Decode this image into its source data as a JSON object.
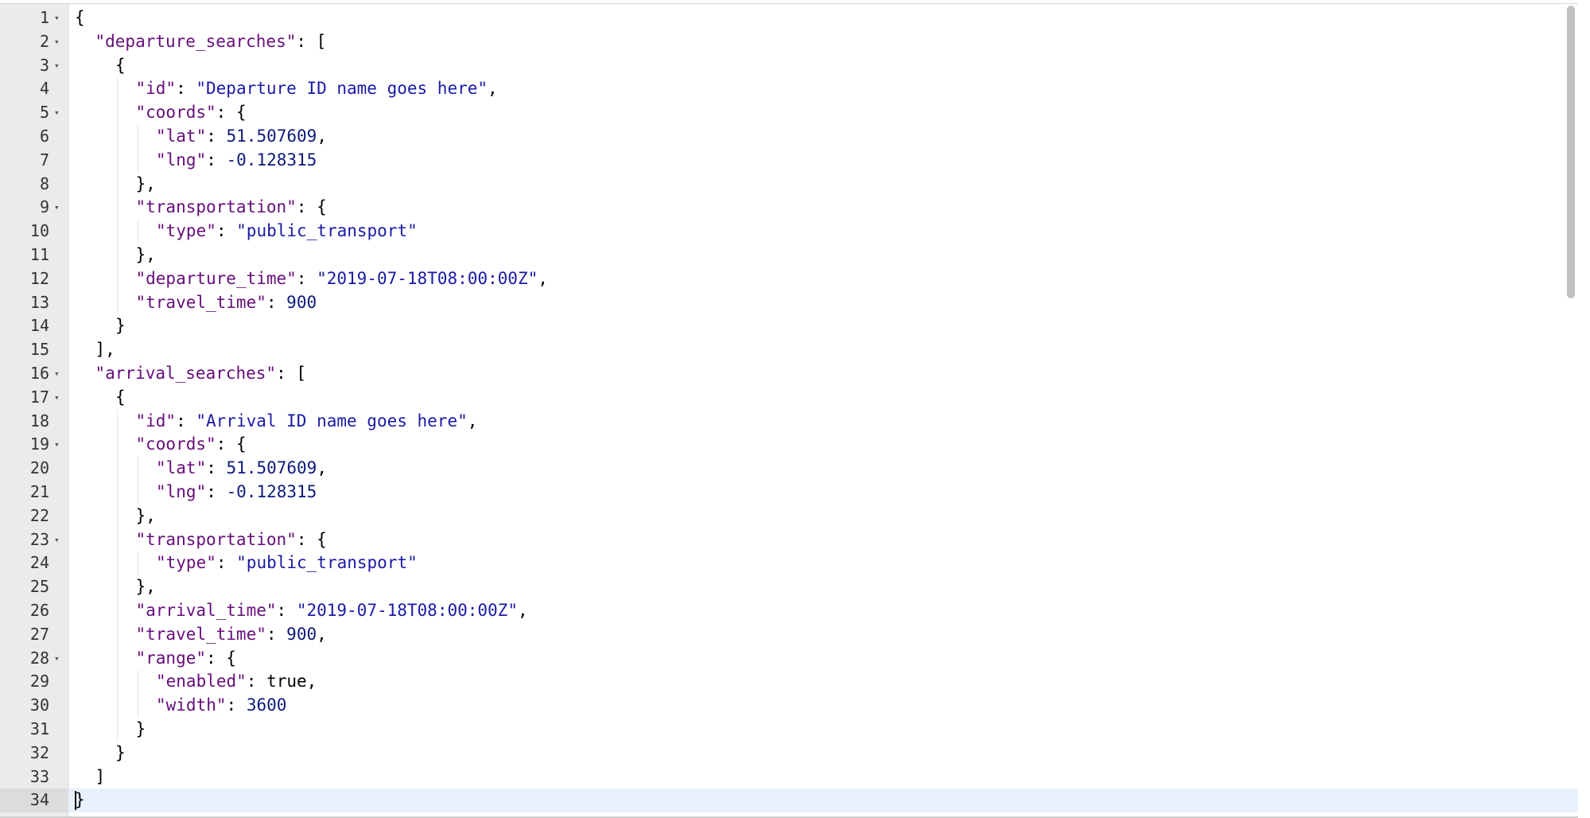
{
  "editor": {
    "lines": [
      {
        "n": "1",
        "fold": true,
        "indent": 0,
        "tokens": [
          {
            "t": "{",
            "c": "b"
          }
        ]
      },
      {
        "n": "2",
        "fold": true,
        "indent": 1,
        "tokens": [
          {
            "t": "\"departure_searches\"",
            "c": "k"
          },
          {
            "t": ": [",
            "c": "b"
          }
        ]
      },
      {
        "n": "3",
        "fold": true,
        "indent": 2,
        "tokens": [
          {
            "t": "{",
            "c": "b"
          }
        ]
      },
      {
        "n": "4",
        "fold": false,
        "indent": 3,
        "tokens": [
          {
            "t": "\"id\"",
            "c": "k"
          },
          {
            "t": ": ",
            "c": "b"
          },
          {
            "t": "\"Departure ID name goes here\"",
            "c": "s"
          },
          {
            "t": ",",
            "c": "b"
          }
        ]
      },
      {
        "n": "5",
        "fold": true,
        "indent": 3,
        "tokens": [
          {
            "t": "\"coords\"",
            "c": "k"
          },
          {
            "t": ": {",
            "c": "b"
          }
        ]
      },
      {
        "n": "6",
        "fold": false,
        "indent": 4,
        "tokens": [
          {
            "t": "\"lat\"",
            "c": "k"
          },
          {
            "t": ": ",
            "c": "b"
          },
          {
            "t": "51.507609",
            "c": "n"
          },
          {
            "t": ",",
            "c": "b"
          }
        ]
      },
      {
        "n": "7",
        "fold": false,
        "indent": 4,
        "tokens": [
          {
            "t": "\"lng\"",
            "c": "k"
          },
          {
            "t": ": ",
            "c": "b"
          },
          {
            "t": "-0.128315",
            "c": "n"
          }
        ]
      },
      {
        "n": "8",
        "fold": false,
        "indent": 3,
        "tokens": [
          {
            "t": "},",
            "c": "b"
          }
        ]
      },
      {
        "n": "9",
        "fold": true,
        "indent": 3,
        "tokens": [
          {
            "t": "\"transportation\"",
            "c": "k"
          },
          {
            "t": ": {",
            "c": "b"
          }
        ]
      },
      {
        "n": "10",
        "fold": false,
        "indent": 4,
        "tokens": [
          {
            "t": "\"type\"",
            "c": "k"
          },
          {
            "t": ": ",
            "c": "b"
          },
          {
            "t": "\"public_transport\"",
            "c": "s"
          }
        ]
      },
      {
        "n": "11",
        "fold": false,
        "indent": 3,
        "tokens": [
          {
            "t": "},",
            "c": "b"
          }
        ]
      },
      {
        "n": "12",
        "fold": false,
        "indent": 3,
        "tokens": [
          {
            "t": "\"departure_time\"",
            "c": "k"
          },
          {
            "t": ": ",
            "c": "b"
          },
          {
            "t": "\"2019-07-18T08:00:00Z\"",
            "c": "s"
          },
          {
            "t": ",",
            "c": "b"
          }
        ]
      },
      {
        "n": "13",
        "fold": false,
        "indent": 3,
        "tokens": [
          {
            "t": "\"travel_time\"",
            "c": "k"
          },
          {
            "t": ": ",
            "c": "b"
          },
          {
            "t": "900",
            "c": "n"
          }
        ]
      },
      {
        "n": "14",
        "fold": false,
        "indent": 2,
        "tokens": [
          {
            "t": "}",
            "c": "b"
          }
        ]
      },
      {
        "n": "15",
        "fold": false,
        "indent": 1,
        "tokens": [
          {
            "t": "],",
            "c": "b"
          }
        ]
      },
      {
        "n": "16",
        "fold": true,
        "indent": 1,
        "tokens": [
          {
            "t": "\"arrival_searches\"",
            "c": "k"
          },
          {
            "t": ": [",
            "c": "b"
          }
        ]
      },
      {
        "n": "17",
        "fold": true,
        "indent": 2,
        "tokens": [
          {
            "t": "{",
            "c": "b"
          }
        ]
      },
      {
        "n": "18",
        "fold": false,
        "indent": 3,
        "tokens": [
          {
            "t": "\"id\"",
            "c": "k"
          },
          {
            "t": ": ",
            "c": "b"
          },
          {
            "t": "\"Arrival ID name goes here\"",
            "c": "s"
          },
          {
            "t": ",",
            "c": "b"
          }
        ]
      },
      {
        "n": "19",
        "fold": true,
        "indent": 3,
        "tokens": [
          {
            "t": "\"coords\"",
            "c": "k"
          },
          {
            "t": ": {",
            "c": "b"
          }
        ]
      },
      {
        "n": "20",
        "fold": false,
        "indent": 4,
        "tokens": [
          {
            "t": "\"lat\"",
            "c": "k"
          },
          {
            "t": ": ",
            "c": "b"
          },
          {
            "t": "51.507609",
            "c": "n"
          },
          {
            "t": ",",
            "c": "b"
          }
        ]
      },
      {
        "n": "21",
        "fold": false,
        "indent": 4,
        "tokens": [
          {
            "t": "\"lng\"",
            "c": "k"
          },
          {
            "t": ": ",
            "c": "b"
          },
          {
            "t": "-0.128315",
            "c": "n"
          }
        ]
      },
      {
        "n": "22",
        "fold": false,
        "indent": 3,
        "tokens": [
          {
            "t": "},",
            "c": "b"
          }
        ]
      },
      {
        "n": "23",
        "fold": true,
        "indent": 3,
        "tokens": [
          {
            "t": "\"transportation\"",
            "c": "k"
          },
          {
            "t": ": {",
            "c": "b"
          }
        ]
      },
      {
        "n": "24",
        "fold": false,
        "indent": 4,
        "tokens": [
          {
            "t": "\"type\"",
            "c": "k"
          },
          {
            "t": ": ",
            "c": "b"
          },
          {
            "t": "\"public_transport\"",
            "c": "s"
          }
        ]
      },
      {
        "n": "25",
        "fold": false,
        "indent": 3,
        "tokens": [
          {
            "t": "},",
            "c": "b"
          }
        ]
      },
      {
        "n": "26",
        "fold": false,
        "indent": 3,
        "tokens": [
          {
            "t": "\"arrival_time\"",
            "c": "k"
          },
          {
            "t": ": ",
            "c": "b"
          },
          {
            "t": "\"2019-07-18T08:00:00Z\"",
            "c": "s"
          },
          {
            "t": ",",
            "c": "b"
          }
        ]
      },
      {
        "n": "27",
        "fold": false,
        "indent": 3,
        "tokens": [
          {
            "t": "\"travel_time\"",
            "c": "k"
          },
          {
            "t": ": ",
            "c": "b"
          },
          {
            "t": "900",
            "c": "n"
          },
          {
            "t": ",",
            "c": "b"
          }
        ]
      },
      {
        "n": "28",
        "fold": true,
        "indent": 3,
        "tokens": [
          {
            "t": "\"range\"",
            "c": "k"
          },
          {
            "t": ": {",
            "c": "b"
          }
        ]
      },
      {
        "n": "29",
        "fold": false,
        "indent": 4,
        "tokens": [
          {
            "t": "\"enabled\"",
            "c": "k"
          },
          {
            "t": ": ",
            "c": "b"
          },
          {
            "t": "true",
            "c": "b"
          },
          {
            "t": ",",
            "c": "b"
          }
        ]
      },
      {
        "n": "30",
        "fold": false,
        "indent": 4,
        "tokens": [
          {
            "t": "\"width\"",
            "c": "k"
          },
          {
            "t": ": ",
            "c": "b"
          },
          {
            "t": "3600",
            "c": "n"
          }
        ]
      },
      {
        "n": "31",
        "fold": false,
        "indent": 3,
        "tokens": [
          {
            "t": "}",
            "c": "b"
          }
        ]
      },
      {
        "n": "32",
        "fold": false,
        "indent": 2,
        "tokens": [
          {
            "t": "}",
            "c": "b"
          }
        ]
      },
      {
        "n": "33",
        "fold": false,
        "indent": 1,
        "tokens": [
          {
            "t": "]",
            "c": "b"
          }
        ]
      },
      {
        "n": "34",
        "fold": false,
        "indent": 0,
        "active": true,
        "tokens": [
          {
            "t": "}",
            "c": "b"
          }
        ]
      }
    ],
    "fold_glyph": "▾",
    "colors": {
      "key": "#660e7a",
      "string": "#1a1aa6",
      "number": "#0d1a7a",
      "active_line": "#e8f2fe"
    }
  }
}
